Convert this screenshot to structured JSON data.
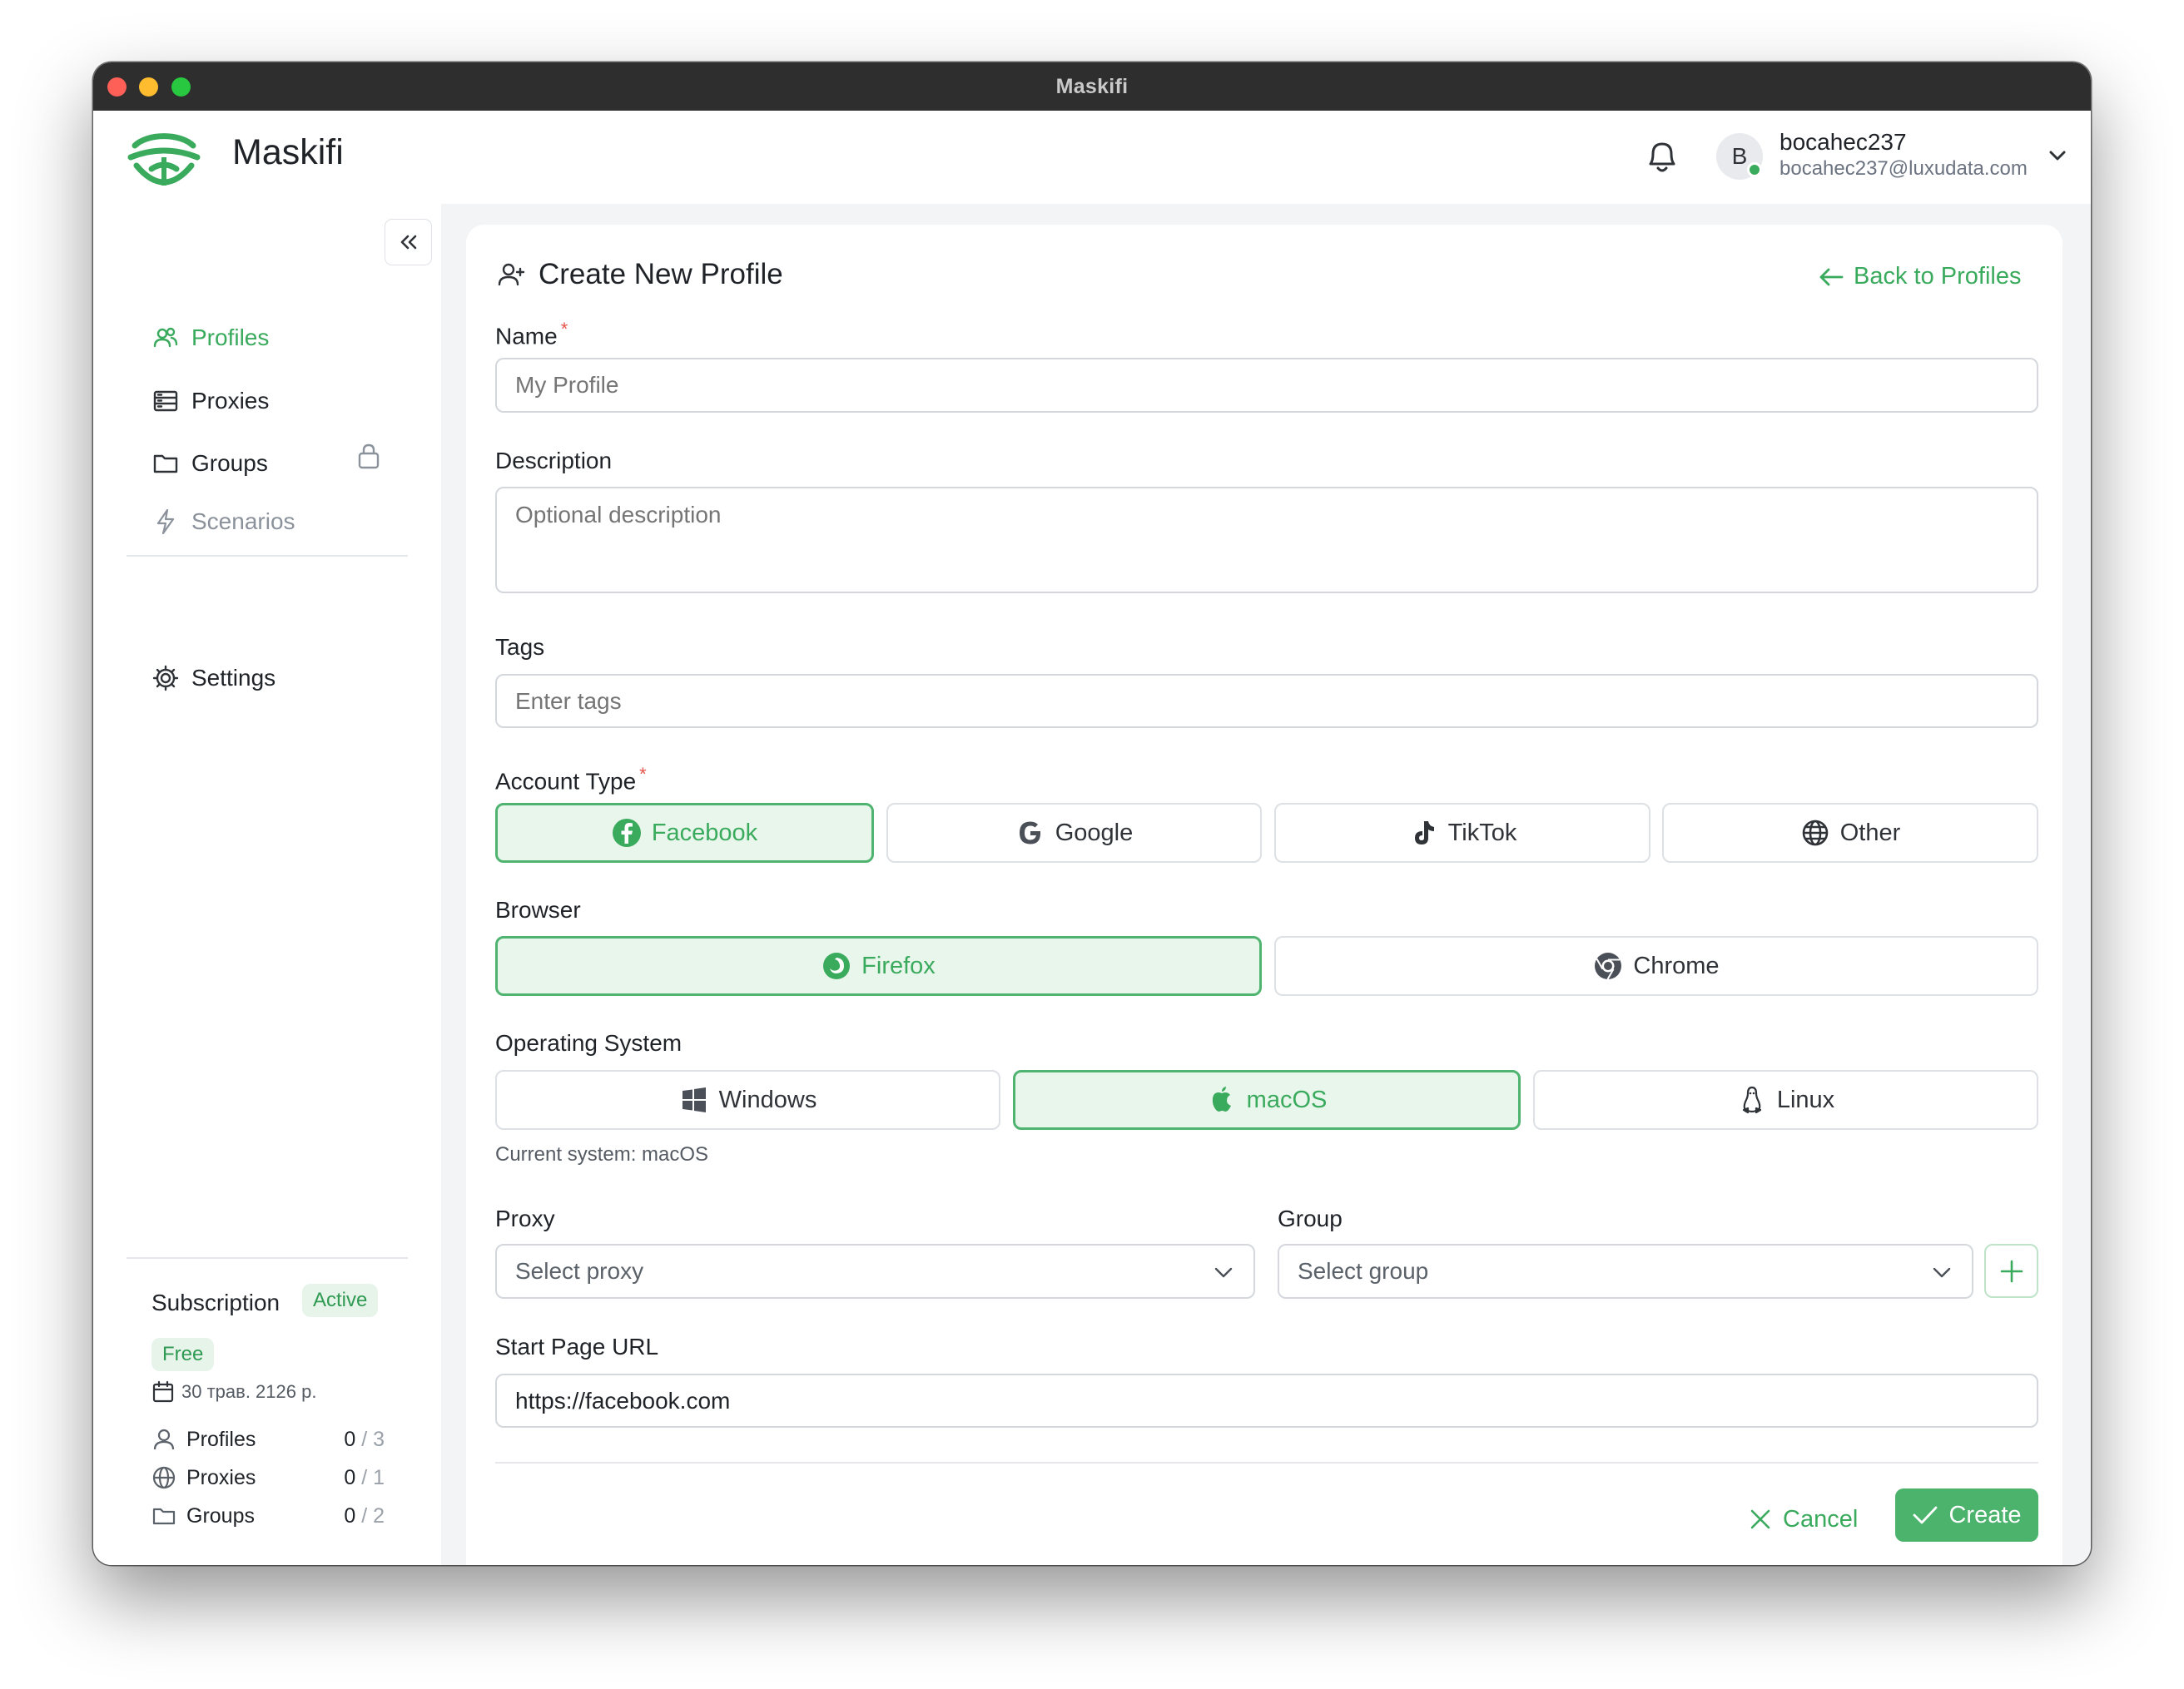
{
  "window": {
    "title": "Maskifi"
  },
  "app": {
    "name": "Maskifi"
  },
  "user": {
    "initial": "B",
    "name": "bocahec237",
    "email": "bocahec237@luxudata.com"
  },
  "sidebar": {
    "items": [
      {
        "label": "Profiles",
        "icon": "users-icon",
        "active": true
      },
      {
        "label": "Proxies",
        "icon": "server-icon"
      },
      {
        "label": "Groups",
        "icon": "folder-icon"
      },
      {
        "label": "Scenarios",
        "icon": "lightning-icon",
        "locked": true
      },
      {
        "label": "Settings",
        "icon": "gear-icon"
      }
    ]
  },
  "subscription": {
    "title": "Subscription",
    "status": "Active",
    "plan": "Free",
    "date": "30 трав. 2126 р.",
    "usage": [
      {
        "label": "Profiles",
        "used": "0",
        "max": "/ 3"
      },
      {
        "label": "Proxies",
        "used": "0",
        "max": "/ 1"
      },
      {
        "label": "Groups",
        "used": "0",
        "max": "/ 2"
      }
    ]
  },
  "form": {
    "title": "Create New Profile",
    "back": "Back to Profiles",
    "name": {
      "label": "Name",
      "required": "*",
      "placeholder": "My Profile"
    },
    "description": {
      "label": "Description",
      "placeholder": "Optional description"
    },
    "tags": {
      "label": "Tags",
      "placeholder": "Enter tags"
    },
    "account_type": {
      "label": "Account Type",
      "required": "*",
      "options": [
        "Facebook",
        "Google",
        "TikTok",
        "Other"
      ],
      "selected": "Facebook"
    },
    "browser": {
      "label": "Browser",
      "options": [
        "Firefox",
        "Chrome"
      ],
      "selected": "Firefox"
    },
    "os": {
      "label": "Operating System",
      "options": [
        "Windows",
        "macOS",
        "Linux"
      ],
      "selected": "macOS",
      "hint": "Current system: macOS"
    },
    "proxy": {
      "label": "Proxy",
      "placeholder": "Select proxy"
    },
    "group": {
      "label": "Group",
      "placeholder": "Select group"
    },
    "start_url": {
      "label": "Start Page URL",
      "value": "https://facebook.com"
    },
    "cancel": "Cancel",
    "create": "Create"
  },
  "colors": {
    "accent": "#3aaa5d",
    "accent_bg": "#e9f6ec",
    "titlebar": "#2e2e2e"
  }
}
